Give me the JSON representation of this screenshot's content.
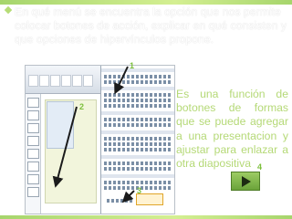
{
  "question": "En qué menú se encuentra la opción que nos permite colocar botones de acción, explicar en qué consisten y que opciones de hipervínculos propone.",
  "description": "Es una función de botones de formas que se puede agregar a una presentacion y ajustar para enlazar a otra diapositiva",
  "callouts": [
    "1",
    "2",
    "3",
    "4"
  ],
  "icons": {
    "action_button": "play-triangle-icon",
    "bullet": "diamond-bullet-icon"
  },
  "colors": {
    "accent_green": "#b5d977",
    "number_green": "#7bbf3a",
    "arrow_dark": "#1b1b1b",
    "button_green": "#6ba33a"
  }
}
